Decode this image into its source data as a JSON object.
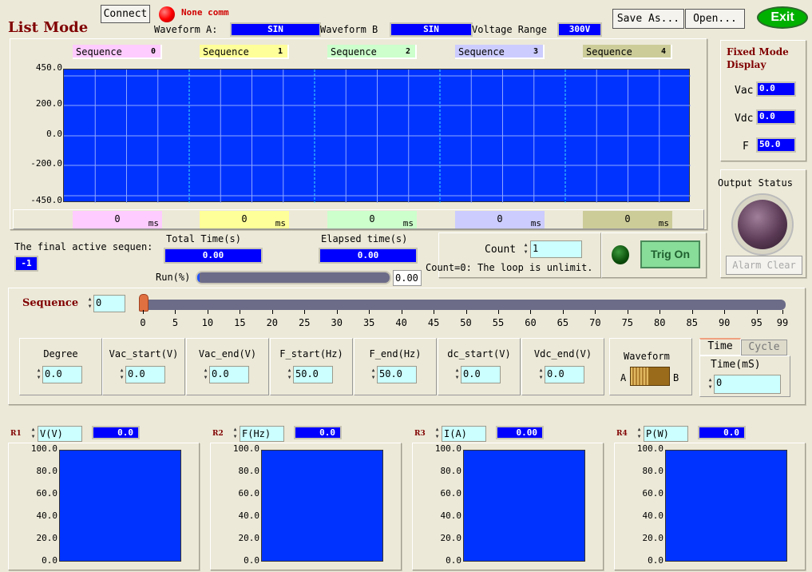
{
  "header": {
    "title": "List Mode",
    "connect_label": "Connect",
    "comm_status": "None comm",
    "comm_led_color": "#ff0000",
    "waveform_a_label": "Waveform A:",
    "waveform_a": "SIN",
    "waveform_b_label": "Waveform B",
    "waveform_b": "SIN",
    "voltage_range_label": "Voltage Range",
    "voltage_range": "300V",
    "save_as_label": "Save As...",
    "open_label": "Open...",
    "exit_label": "Exit"
  },
  "sequences": [
    {
      "label": "Sequence",
      "index": "0",
      "time": "0",
      "unit": "ms",
      "color": "#ffccff"
    },
    {
      "label": "Sequence",
      "index": "1",
      "time": "0",
      "unit": "ms",
      "color": "#ffff99"
    },
    {
      "label": "Sequence",
      "index": "2",
      "time": "0",
      "unit": "ms",
      "color": "#ccffcc"
    },
    {
      "label": "Sequence",
      "index": "3",
      "time": "0",
      "unit": "ms",
      "color": "#ccccff"
    },
    {
      "label": "Sequence",
      "index": "4",
      "time": "0",
      "unit": "ms",
      "color": "#cccc99"
    }
  ],
  "main_chart": {
    "y_ticks": [
      "450.0",
      "200.0",
      "0.0",
      "-200.0",
      "-450.0"
    ],
    "plot_color": "#0033ff"
  },
  "fixed_mode": {
    "title": "Fixed Mode Display",
    "vac_label": "Vac",
    "vac": "0.0",
    "vdc_label": "Vdc",
    "vdc": "0.0",
    "f_label": "F",
    "f": "50.0"
  },
  "output_status": {
    "label": "Output Status",
    "alarm_clear_label": "Alarm Clear"
  },
  "status": {
    "final_active_label": "The final active sequen:",
    "final_active": "-1",
    "total_time_label": "Total Time(s)",
    "total_time": "0.00",
    "elapsed_label": "Elapsed time(s)",
    "elapsed": "0.00",
    "run_label": "Run(%)",
    "run_value": "0.00",
    "run_percent": 0,
    "count_label": "Count",
    "count": "1",
    "count_note": "Count=0: The loop is unlimit.",
    "trig_label": "Trig On"
  },
  "sequence_editor": {
    "label": "Sequence",
    "value": "0",
    "slider_value": 0,
    "slider_ticks": [
      "0",
      "5",
      "10",
      "15",
      "20",
      "25",
      "30",
      "35",
      "40",
      "45",
      "50",
      "55",
      "60",
      "65",
      "70",
      "75",
      "80",
      "85",
      "90",
      "95",
      "99"
    ],
    "fields": [
      {
        "label": "Degree",
        "value": "0.0"
      },
      {
        "label": "Vac_start(V)",
        "value": "0.0"
      },
      {
        "label": "Vac_end(V)",
        "value": "0.0"
      },
      {
        "label": "F_start(Hz)",
        "value": "50.0"
      },
      {
        "label": "F_end(Hz)",
        "value": "50.0"
      },
      {
        "label": "dc_start(V)",
        "value": "0.0"
      },
      {
        "label": "Vdc_end(V)",
        "value": "0.0"
      }
    ],
    "waveform_label": "Waveform",
    "switch_a": "A",
    "switch_b": "B",
    "tab_time": "Time",
    "tab_cycle": "Cycle",
    "time_label": "Time(mS)",
    "time_value": "0"
  },
  "readouts": [
    {
      "tag": "R1",
      "param": "V(V)",
      "value": "0.0"
    },
    {
      "tag": "R2",
      "param": "F(Hz)",
      "value": "0.0"
    },
    {
      "tag": "R3",
      "param": "I(A)",
      "value": "0.00"
    },
    {
      "tag": "R4",
      "param": "P(W)",
      "value": "0.0"
    }
  ],
  "small_chart_ticks": [
    "100.0",
    "80.0",
    "60.0",
    "40.0",
    "20.0",
    "0.0"
  ]
}
